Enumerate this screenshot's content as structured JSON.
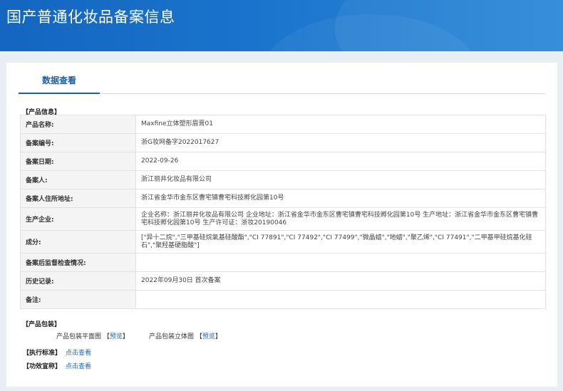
{
  "header": {
    "title": "国产普通化妆品备案信息"
  },
  "tabs": [
    {
      "label": "数据查看"
    }
  ],
  "product_info": {
    "section_title": "【产品信息】",
    "rows": [
      {
        "key": "产品名称:",
        "value": "Maxfine立体塑形眉膏01"
      },
      {
        "key": "备案编号:",
        "value": "浙G妆网备字2022017627"
      },
      {
        "key": "备案日期:",
        "value": "2022-09-26"
      },
      {
        "key": "备案人:",
        "value": "浙江丽井化妆品有限公司"
      },
      {
        "key": "备案人住所地址:",
        "value": "浙江省金华市金东区曹宅镇曹宅科技孵化园第10号"
      },
      {
        "key": "生产企业:",
        "value": "企业名称：浙江丽井化妆品有限公司 企业地址：浙江省金华市金东区曹宅镇曹宅科技孵化园第10号 生产地址：浙江省金华市金东区曹宅镇曹宅科技孵化园第10号 生产许可证：浙妆20190046"
      },
      {
        "key": "成分:",
        "value": "[\"异十二烷\",\"三甲基硅烷氧基硅酸酯\",\"CI 77891\",\"CI 77492\",\"CI 77499\",\"微晶蜡\",\"地蜡\",\"聚乙烯\",\"CI 77491\",\"二甲基甲硅烷基化硅石\",\"聚羟基硬脂酸\"]"
      },
      {
        "key": "备案后监督检查情况:",
        "value": ""
      },
      {
        "key": "历史记录:",
        "value": "2022年09月30日 首次备案"
      },
      {
        "key": "备注:",
        "value": ""
      }
    ]
  },
  "packaging": {
    "section_title": "【产品包装】",
    "flat_label": "产品包装平面图",
    "stereo_label": "产品包装立体图",
    "bracket_open": "【",
    "bracket_close": "】",
    "preview_label": "预览"
  },
  "standards": {
    "label": "【执行标准】",
    "link": "点击查看"
  },
  "efficacy": {
    "label": "【功效宣称】",
    "link": "点击查看"
  },
  "colors": {
    "banner": "#1a6cc6",
    "accent": "#1a5fa8",
    "link": "#1a66c4",
    "table_border": "#a9c4e4"
  }
}
